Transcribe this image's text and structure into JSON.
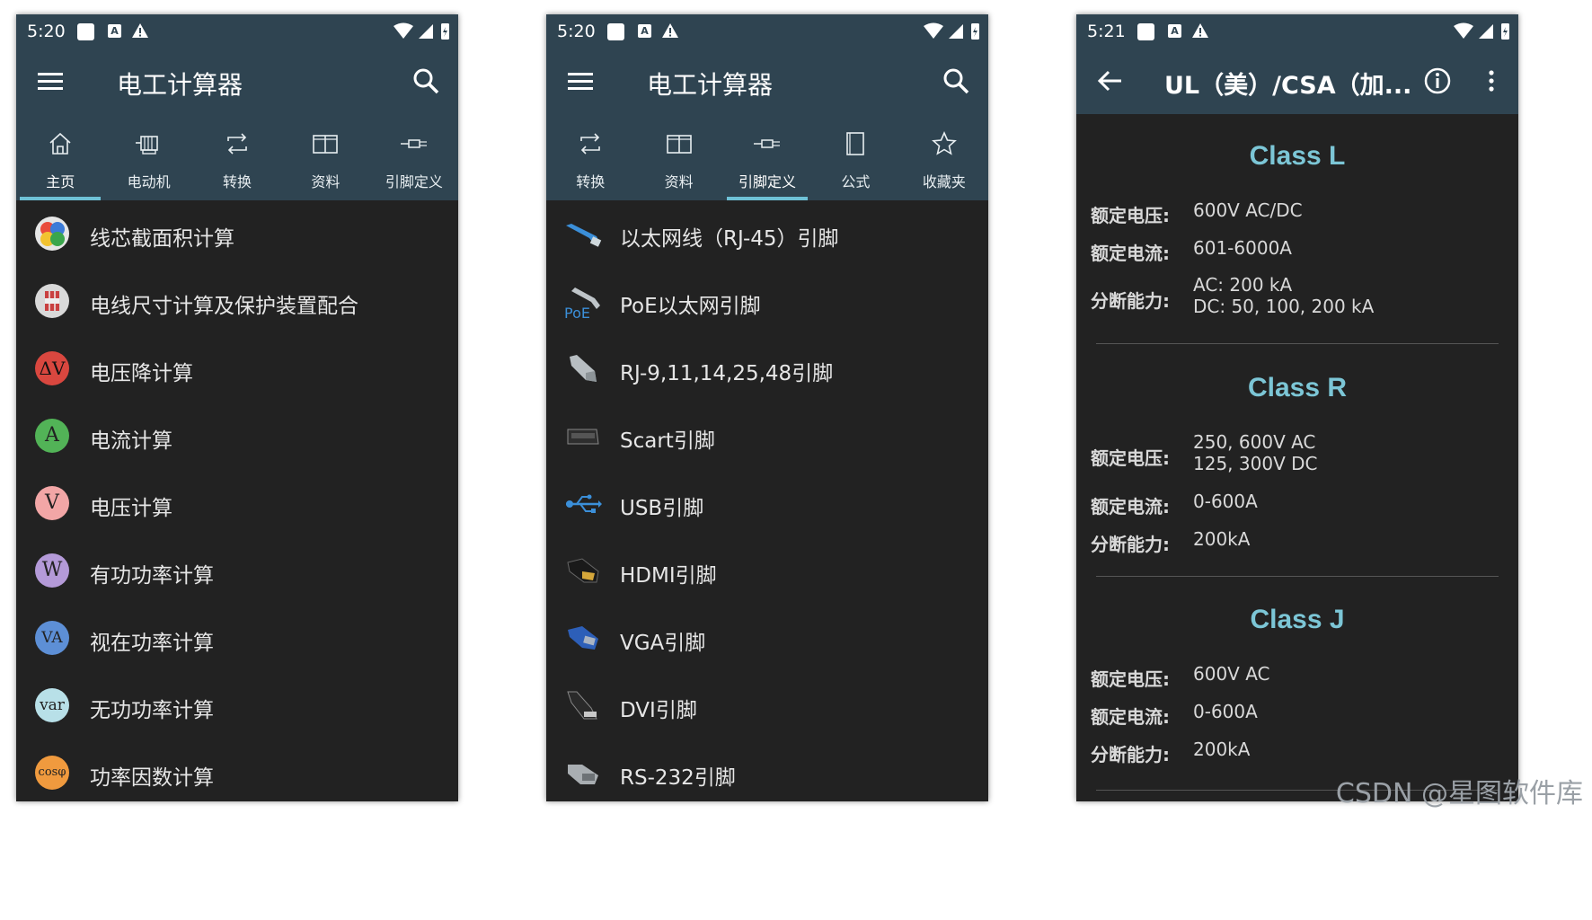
{
  "watermark": "CSDN @星图软件库",
  "phone1": {
    "status_time": "5:20",
    "title": "电工计算器",
    "tabs": [
      "主页",
      "电动机",
      "转换",
      "资料",
      "引脚定义"
    ],
    "active_tab": 0,
    "items": [
      {
        "label": "线芯截面积计算",
        "icon": "color-circles-icon"
      },
      {
        "label": "电线尺寸计算及保护装置配合",
        "icon": "wire-fuse-icon"
      },
      {
        "label": "电压降计算",
        "icon": "voltage-drop-icon",
        "glyph": "ΔV",
        "color": "#d9473f"
      },
      {
        "label": "电流计算",
        "icon": "ampere-icon",
        "glyph": "A",
        "color": "#52b357"
      },
      {
        "label": "电压计算",
        "icon": "volt-icon",
        "glyph": "V",
        "color": "#f2a6a6"
      },
      {
        "label": "有功功率计算",
        "icon": "watt-icon",
        "glyph": "W",
        "color": "#b49ad8"
      },
      {
        "label": "视在功率计算",
        "icon": "va-icon",
        "glyph": "VA",
        "color": "#5d8fd6"
      },
      {
        "label": "无功功率计算",
        "icon": "var-icon",
        "glyph": "var",
        "color": "#b8e0e8"
      },
      {
        "label": "功率因数计算",
        "icon": "cos-phi-icon",
        "glyph": "cosφ",
        "color": "#f09a3e"
      }
    ]
  },
  "phone2": {
    "status_time": "5:20",
    "title": "电工计算器",
    "tabs": [
      "转换",
      "资料",
      "引脚定义",
      "公式",
      "收藏夹"
    ],
    "active_tab": 2,
    "items": [
      {
        "label": "以太网线（RJ-45）引脚",
        "icon": "ethernet-cable-icon"
      },
      {
        "label": "PoE以太网引脚",
        "icon": "poe-cable-icon"
      },
      {
        "label": "RJ-9,11,14,25,48引脚",
        "icon": "rj-connector-icon"
      },
      {
        "label": "Scart引脚",
        "icon": "scart-connector-icon"
      },
      {
        "label": "USB引脚",
        "icon": "usb-icon"
      },
      {
        "label": "HDMI引脚",
        "icon": "hdmi-connector-icon"
      },
      {
        "label": "VGA引脚",
        "icon": "vga-connector-icon"
      },
      {
        "label": "DVI引脚",
        "icon": "dvi-connector-icon"
      },
      {
        "label": "RS-232引脚",
        "icon": "rs232-connector-icon"
      }
    ]
  },
  "phone3": {
    "status_time": "5:21",
    "title": "UL（美）/CSA（加...",
    "labels": {
      "voltage": "额定电压:",
      "current": "额定电流:",
      "breaking": "分断能力:"
    },
    "classes": [
      {
        "name": "Class L",
        "voltage": [
          "600V AC/DC"
        ],
        "current": "601-6000A",
        "breaking": [
          "AC: 200 kA",
          "DC: 50, 100, 200 kA"
        ]
      },
      {
        "name": "Class R",
        "voltage": [
          "250, 600V AC",
          "125, 300V DC"
        ],
        "current": "0-600A",
        "breaking": [
          "200kA"
        ]
      },
      {
        "name": "Class J",
        "voltage": [
          "600V AC"
        ],
        "current": "0-600A",
        "breaking": [
          "200kA"
        ]
      }
    ]
  },
  "colors": {
    "bar": "#2f4451",
    "background": "#222222",
    "accent": "#6ec1d6",
    "class_title": "#7cc6d6"
  }
}
